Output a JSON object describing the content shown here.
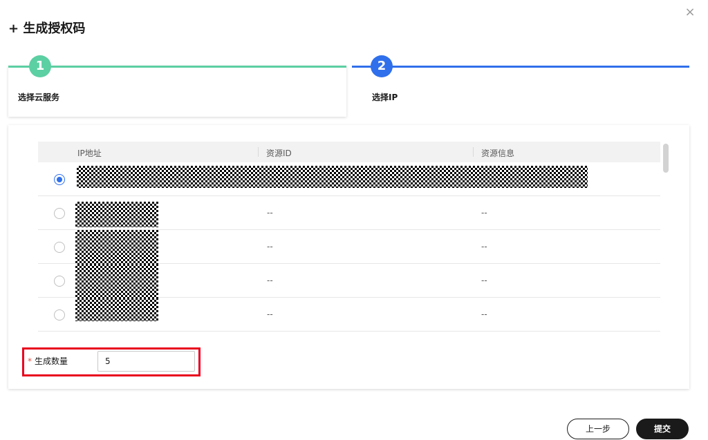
{
  "dialog": {
    "title": "+ 生成授权码",
    "close_icon": "×"
  },
  "steps": [
    {
      "number": "1",
      "label": "选择云服务",
      "status": "done",
      "color": "#5ccfa3"
    },
    {
      "number": "2",
      "label": "选择IP",
      "status": "active",
      "color": "#2f6feb"
    }
  ],
  "table": {
    "columns": [
      "IP地址",
      "资源ID",
      "资源信息"
    ],
    "rows": [
      {
        "selected": true,
        "ip": "",
        "resource_id": "",
        "resource_info": ""
      },
      {
        "selected": false,
        "ip": "",
        "resource_id": "--",
        "resource_info": "--"
      },
      {
        "selected": false,
        "ip": "",
        "resource_id": "--",
        "resource_info": "--"
      },
      {
        "selected": false,
        "ip": "",
        "resource_id": "--",
        "resource_info": "--"
      },
      {
        "selected": false,
        "ip": "",
        "resource_id": "--",
        "resource_info": "--"
      }
    ]
  },
  "quantity": {
    "required_mark": "*",
    "label": "生成数量",
    "value": "5"
  },
  "footer": {
    "prev_label": "上一步",
    "submit_label": "提交"
  },
  "colors": {
    "accent_blue": "#2f6feb",
    "accent_green": "#5ccfa3",
    "highlight_red": "#e8001c"
  }
}
